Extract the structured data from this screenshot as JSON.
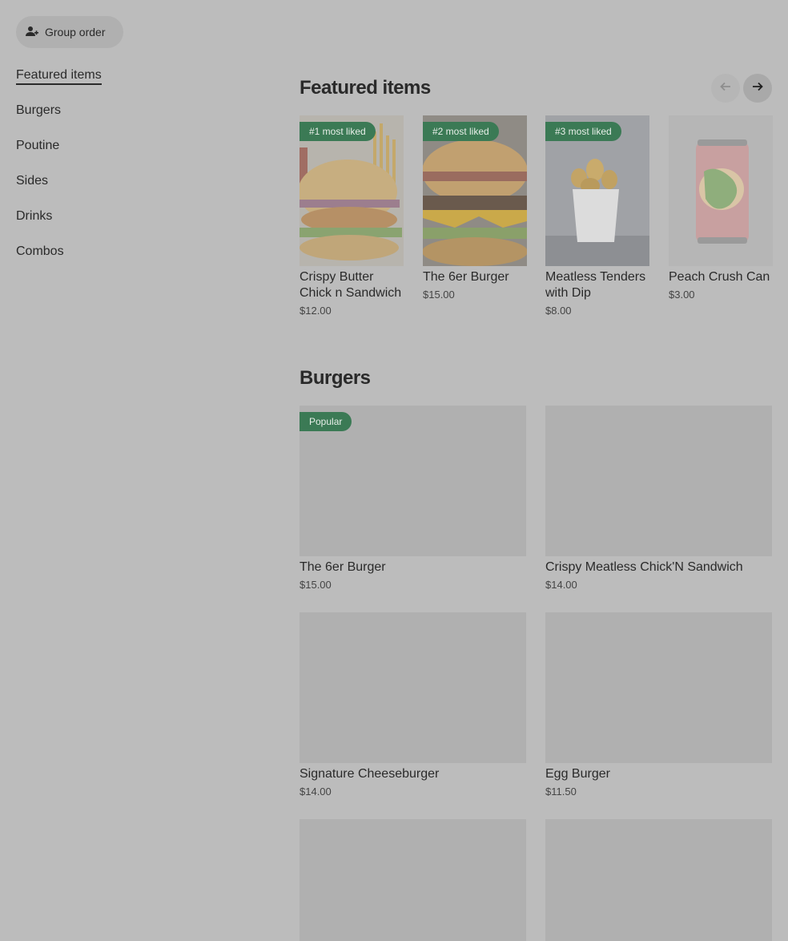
{
  "header": {
    "group_order_label": "Group order"
  },
  "sidebar": {
    "items": [
      {
        "label": "Featured items"
      },
      {
        "label": "Burgers"
      },
      {
        "label": "Poutine"
      },
      {
        "label": "Sides"
      },
      {
        "label": "Drinks"
      },
      {
        "label": "Combos"
      }
    ]
  },
  "featured": {
    "title": "Featured items",
    "items": [
      {
        "badge": "#1 most liked",
        "name": "Crispy Butter Chick n Sandwich",
        "price": "$12.00"
      },
      {
        "badge": "#2 most liked",
        "name": "The 6er Burger",
        "price": "$15.00"
      },
      {
        "badge": "#3 most liked",
        "name": "Meatless Tenders with Dip",
        "price": "$8.00"
      },
      {
        "badge": "",
        "name": "Peach Crush Can",
        "price": "$3.00"
      }
    ]
  },
  "burgers": {
    "title": "Burgers",
    "items": [
      {
        "badge": "Popular",
        "name": "The 6er Burger",
        "price": "$15.00"
      },
      {
        "badge": "",
        "name": "Crispy Meatless Chick'N Sandwich",
        "price": "$14.00"
      },
      {
        "badge": "",
        "name": "Signature Cheeseburger",
        "price": "$14.00"
      },
      {
        "badge": "",
        "name": "Egg Burger",
        "price": "$11.50"
      },
      {
        "badge": "",
        "name": "",
        "price": ""
      },
      {
        "badge": "",
        "name": "",
        "price": ""
      }
    ]
  },
  "colors": {
    "overlay_bg": "#bcbcbc",
    "badge_green": "#3b7a55",
    "text": "#2a2a2a"
  }
}
